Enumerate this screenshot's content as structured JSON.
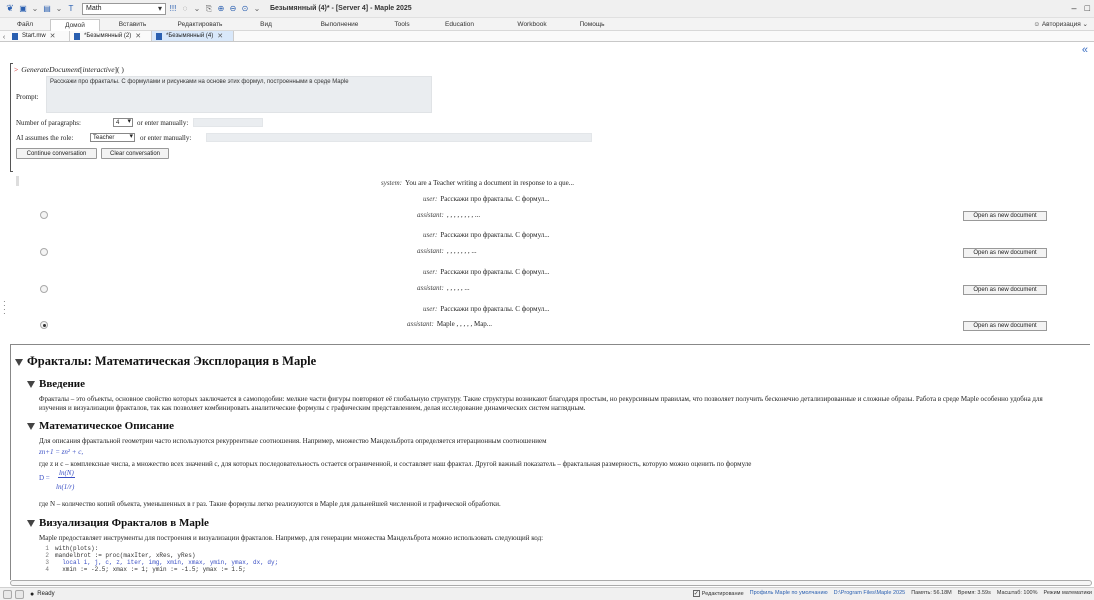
{
  "window": {
    "math_mode": "Math",
    "title": "Безымянный (4)* - [Server 4] - Maple 2025"
  },
  "menu": {
    "items": [
      "Файл",
      "Домой",
      "Вставить",
      "Редактировать",
      "Вид",
      "Выполнение",
      "Tools",
      "Education",
      "Workbook",
      "Помощь"
    ],
    "active_index": 1,
    "auth": "Авторизация"
  },
  "tabs": [
    {
      "label": "Start.mw"
    },
    {
      "label": "*Безымянный (2)"
    },
    {
      "label": "*Безымянный (4)"
    }
  ],
  "command": {
    "prompt_symbol": ">",
    "func": "GenerateDocument",
    "arg": "interactive",
    "tail": "]( )"
  },
  "form": {
    "prompt_label": "Prompt:",
    "prompt_text": "Расскажи про фракталы. С формулами и рисунками на основе этих формул, построенными в среде Maple",
    "paragraphs_label": "Number of paragraphs:",
    "paragraphs_value": "4",
    "or_manual": "or enter manually:",
    "role_label": "AI assumes the role:",
    "role_value": "Teacher",
    "continue_button": "Continue conversation",
    "clear_button": "Clear conversation"
  },
  "conversation": {
    "system_label": "system:",
    "system_text": "You are a Teacher writing a document in response to a que...",
    "user_label": "user:",
    "user_text": "Расскажи про фракталы. С формул...",
    "assistant_label": "assistant:",
    "assistant_texts": [
      ",    ,    , ,   ,     ,  , , ...",
      ", , ,     ,     ,    , , ...",
      ",     ,     ,     ,   , ...",
      "Maple   ,          ,  , ,      ,  Map..."
    ],
    "open_button": "Open as new document",
    "selected_index": 3
  },
  "document": {
    "title": "Фракталы: Математическая Эксплорация в Maple",
    "sections": [
      {
        "heading": "Введение",
        "text": "Фракталы – это объекты, основное свойство которых заключается в самоподобии: мелкие части фигуры повторяют её глобальную структуру. Такие структуры возникают благодаря простым, но рекурсивным правилам, что позволяет получить бесконечно детализированные и сложные образы. Работа в среде Maple особенно удобна для изучения и визуализации фракталов, так как позволяет комбинировать аналитические формулы с графическим представлением, делая исследование динамических систем наглядным."
      },
      {
        "heading": "Математическое Описание",
        "text1": "Для описания фрактальной геометрии часто используются рекуррентные соотношения. Например, множество Мандельброта определяется итерационным соотношением",
        "formula1": "zn+1 = zn² + c,",
        "text2": "где z и c – комплексные числа, а множество всех значений c, для которых последовательность остается ограниченной, и составляет наш фрактал. Другой важный показатель – фрактальная размерность, которую можно оценить по формуле",
        "formula2_lhs": "D =",
        "formula2_num": "ln(N)",
        "formula2_den": "ln(1/r)",
        "text3": "где N – количество копий объекта, уменьшенных в r раз. Такие формулы легко реализуются в Maple для дальнейшей численной и графической обработки."
      },
      {
        "heading": "Визуализация Фракталов в Maple",
        "text": "Maple предоставляет инструменты для построения и визуализации фракталов. Например, для генерации множества Мандельброта можно использовать следующий код:",
        "code": [
          {
            "n": "1",
            "line": "with(plots):"
          },
          {
            "n": "2",
            "line": "mandelbrot := proc(maxIter, xRes, yRes)"
          },
          {
            "n": "3",
            "line": "  local i, j, c, z, iter, img, xmin, xmax, ymin, ymax, dx, dy;"
          },
          {
            "n": "4",
            "line": "  xmin := -2.5; xmax := 1; ymin := -1.5; ymax := 1.5;"
          }
        ]
      }
    ]
  },
  "status": {
    "ready": "Ready",
    "editing": "Редактирование",
    "profile": "Профиль Maple по умолчанию",
    "path": "D:\\Program Files\\Maple 2025",
    "memory": "Память: 56.18M",
    "time": "Время: 3.59s",
    "zoom": "Масштаб: 100%",
    "mode": "Режим математики"
  },
  "colors": {
    "accent": "#2a5fb0",
    "math_blue": "#3a4fc4",
    "input_bg": "#eaedf0",
    "prompt_red": "#cc0000"
  }
}
